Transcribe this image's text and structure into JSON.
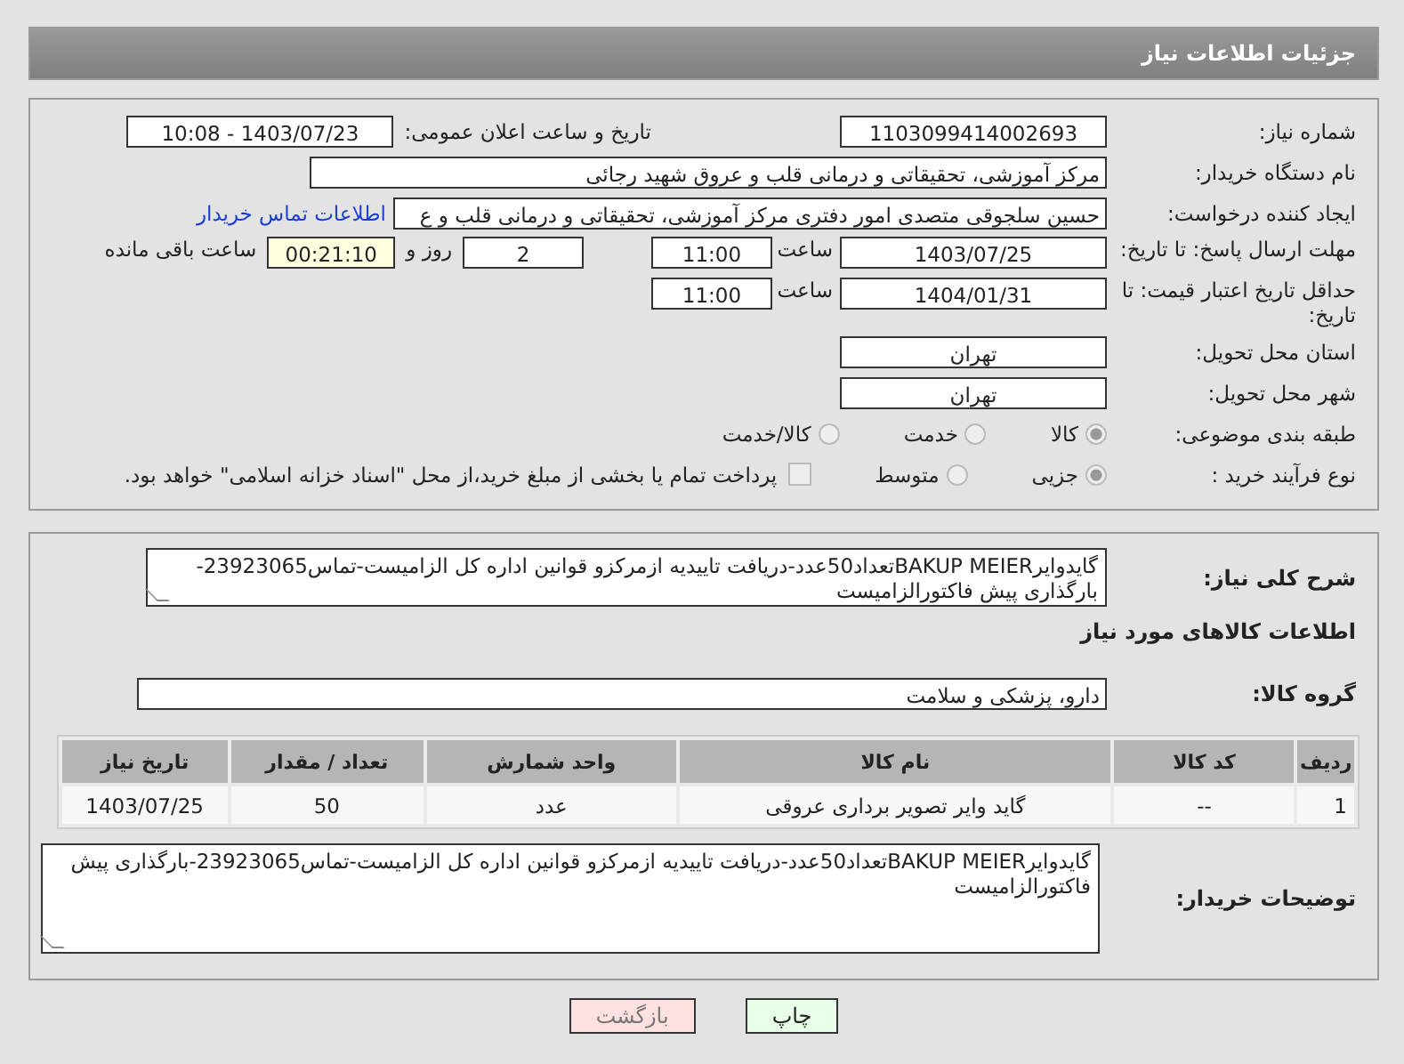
{
  "header": {
    "title": "جزئیات اطلاعات نیاز"
  },
  "need_number": {
    "label": "شماره نیاز:",
    "value": "1103099414002693"
  },
  "announce": {
    "label": "تاریخ و ساعت اعلان عمومی:",
    "value": "1403/07/23 - 10:08"
  },
  "buyer_org": {
    "label": "نام دستگاه خریدار:",
    "value": "مرکز آموزشی، تحقیقاتی و درمانی قلب و عروق شهید رجائی"
  },
  "requester": {
    "label": "ایجاد کننده درخواست:",
    "value": "حسین سلجوقی متصدی امور دفتری مرکز آموزشی، تحقیقاتی و درمانی قلب و ع",
    "link": "اطلاعات تماس خریدار"
  },
  "deadline": {
    "label": "مهلت ارسال پاسخ: تا تاریخ:",
    "date": "1403/07/25",
    "time_label": "ساعت",
    "time": "11:00",
    "days": "2",
    "days_label": "روز و",
    "remaining": "00:21:10",
    "remaining_label": "ساعت باقی مانده"
  },
  "validity": {
    "label": "حداقل تاریخ اعتبار قیمت: تا تاریخ:",
    "date": "1404/01/31",
    "time_label": "ساعت",
    "time": "11:00"
  },
  "province": {
    "label": "استان محل تحویل:",
    "value": "تهران"
  },
  "city": {
    "label": "شهر محل تحویل:",
    "value": "تهران"
  },
  "category": {
    "label": "طبقه بندی موضوعی:",
    "options": [
      {
        "label": "کالا",
        "selected": true
      },
      {
        "label": "خدمت",
        "selected": false
      },
      {
        "label": "کالا/خدمت",
        "selected": false
      }
    ]
  },
  "process": {
    "label": "نوع فرآیند خرید :",
    "options": [
      {
        "label": "جزیی",
        "selected": true
      },
      {
        "label": "متوسط",
        "selected": false
      }
    ],
    "payment": {
      "label": "پرداخت تمام یا بخشی از مبلغ خرید،از محل \"اسناد خزانه اسلامی\" خواهد بود.",
      "checked": false
    }
  },
  "description": {
    "label": "شرح کلی نیاز:",
    "value": "گایدوایرBAKUP MEIERتعداد50عدد-دریافت تاییدیه ازمرکزو قوانین اداره کل الزامیست-تماس23923065-بارگذاری پیش فاکتورالزامیست"
  },
  "goods": {
    "title": "اطلاعات کالاهای مورد نیاز",
    "group_label": "گروه کالا:",
    "group_value": "دارو، پزشکی و سلامت",
    "columns": [
      "ردیف",
      "کد کالا",
      "نام کالا",
      "واحد شمارش",
      "تعداد / مقدار",
      "تاریخ نیاز"
    ],
    "rows": [
      [
        "1",
        "--",
        "گاید وایر تصویر برداری عروقی",
        "عدد",
        "50",
        "1403/07/25"
      ]
    ]
  },
  "notes": {
    "label": "توضیحات خریدار:",
    "value": "گایدوایرBAKUP MEIERتعداد50عدد-دریافت تاییدیه ازمرکزو قوانین اداره کل الزامیست-تماس23923065-بارگذاری پیش فاکتورالزامیست"
  },
  "buttons": [
    {
      "kind": "print",
      "label": "چاپ"
    },
    {
      "kind": "back",
      "label": "بازگشت"
    }
  ]
}
